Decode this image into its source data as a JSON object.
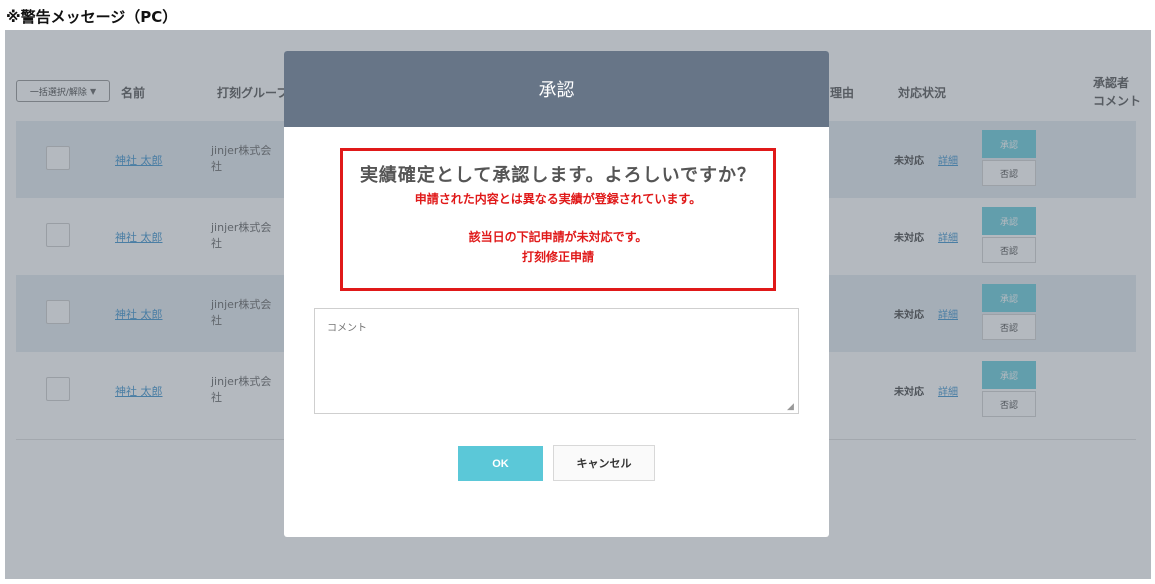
{
  "page_heading": "※警告メッセージ（PC）",
  "table": {
    "bulk_select_label": "一括選択/解除",
    "bulk_select_caret": "▼",
    "headers": {
      "name": "名前",
      "group": "打刻グルーフ",
      "reason": "理由",
      "status": "対応状況",
      "approver_comment_line1": "承認者",
      "approver_comment_line2": "コメント"
    },
    "rows": [
      {
        "name": "神社 太郎",
        "group": "jinjer株式会社",
        "status": "未対応",
        "detail": "詳細",
        "approve": "承認",
        "reject": "否認"
      },
      {
        "name": "神社 太郎",
        "group": "jinjer株式会社",
        "status": "未対応",
        "detail": "詳細",
        "approve": "承認",
        "reject": "否認"
      },
      {
        "name": "神社 太郎",
        "group": "jinjer株式会社",
        "status": "未対応",
        "detail": "詳細",
        "approve": "承認",
        "reject": "否認"
      },
      {
        "name": "神社 太郎",
        "group": "jinjer株式会社",
        "status": "未対応",
        "detail": "詳細",
        "approve": "承認",
        "reject": "否認"
      }
    ]
  },
  "modal": {
    "title": "承認",
    "warning_main": "実績確定として承認します。よろしいですか？",
    "warning_line1": "申請された内容とは異なる実績が登録されています。",
    "warning_line2": "該当日の下記申請が未対応です。",
    "warning_line3": "打刻修正申請",
    "comment_placeholder": "コメント",
    "resize_grip": "◢",
    "ok_label": "OK",
    "cancel_label": "キャンセル"
  },
  "colors": {
    "accent": "#5bc8d8",
    "modal_header": "#677587",
    "warning_red": "#e01919",
    "link_blue": "#2b88c8"
  }
}
